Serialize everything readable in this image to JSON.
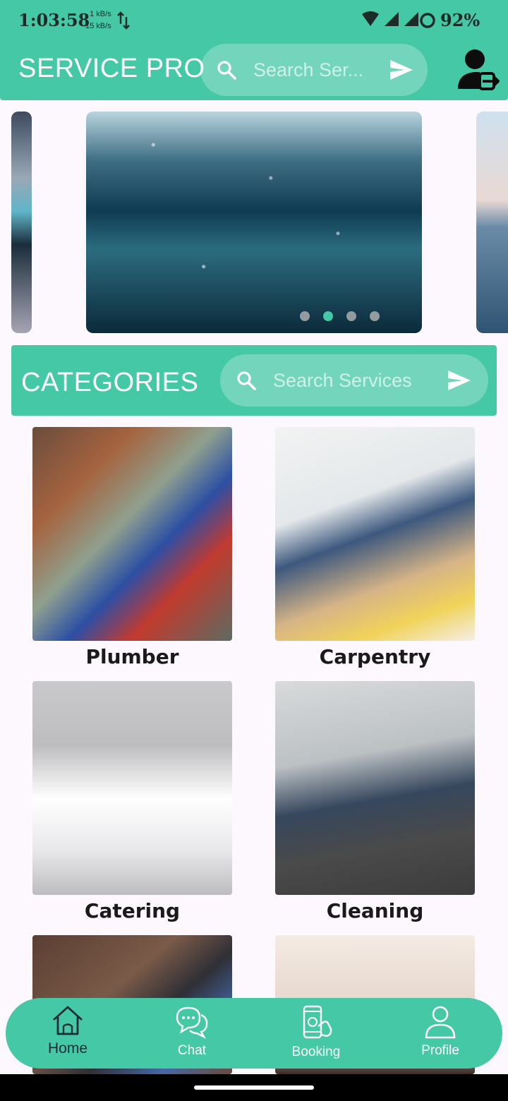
{
  "status_bar": {
    "time": "1:03:58",
    "speed_up": "1 kB/s",
    "speed_down": "15 kB/s",
    "battery": "92%",
    "icons": [
      "data-transfer-icon",
      "wifi-icon",
      "signal-icon",
      "signal-icon",
      "battery-icon"
    ]
  },
  "app_bar": {
    "title": "SERVICE PRO",
    "search_placeholder": "Search Ser...",
    "icons": [
      "search-icon",
      "send-icon",
      "logout-icon"
    ]
  },
  "carousel": {
    "slide_count": 4,
    "active_index": 1
  },
  "categories": {
    "title": "CATEGORIES",
    "search_placeholder": "Search Services",
    "items": [
      {
        "label": "Plumber"
      },
      {
        "label": "Carpentry"
      },
      {
        "label": "Catering"
      },
      {
        "label": "Cleaning"
      },
      {
        "label": ""
      },
      {
        "label": ""
      }
    ]
  },
  "bottom_nav": {
    "items": [
      {
        "label": "Home",
        "icon": "home-icon",
        "active": true
      },
      {
        "label": "Chat",
        "icon": "chat-icon",
        "active": false
      },
      {
        "label": "Booking",
        "icon": "booking-icon",
        "active": false
      },
      {
        "label": "Profile",
        "icon": "profile-icon",
        "active": false
      }
    ]
  },
  "colors": {
    "accent": "#45c8a6",
    "background": "#fdf8fd",
    "text_dark": "#1a1a1a"
  }
}
